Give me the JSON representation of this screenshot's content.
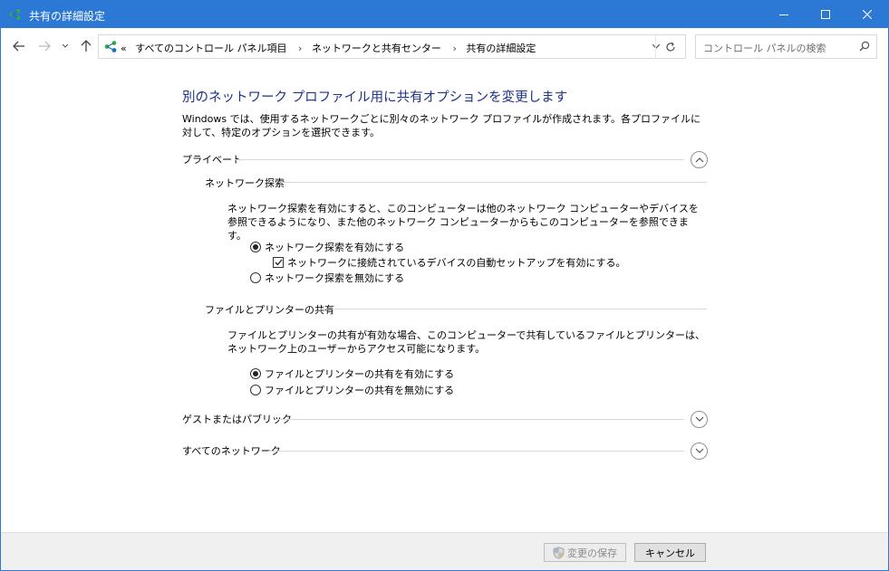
{
  "window": {
    "title": "共有の詳細設定"
  },
  "nav": {
    "breadcrumb_prefix": "«",
    "breadcrumbs": [
      "すべてのコントロール パネル項目",
      "ネットワークと共有センター",
      "共有の詳細設定"
    ],
    "separator": "›",
    "search_placeholder": "コントロール パネルの検索"
  },
  "main": {
    "heading": "別のネットワーク プロファイル用に共有オプションを変更します",
    "description": "Windows では、使用するネットワークごとに別々のネットワーク プロファイルが作成されます。各プロファイルに対して、特定のオプションを選択できます。",
    "profiles": {
      "private": {
        "label": "プライベート",
        "expanded": true
      },
      "guest": {
        "label": "ゲストまたはパブリック",
        "expanded": false
      },
      "all": {
        "label": "すべてのネットワーク",
        "expanded": false
      }
    },
    "discovery": {
      "label": "ネットワーク探索",
      "description": "ネットワーク探索を有効にすると、このコンピューターは他のネットワーク コンピューターやデバイスを参照できるようになり、また他のネットワーク コンピューターからもこのコンピューターを参照できます。",
      "on_label": "ネットワーク探索を有効にする",
      "auto_setup_label": "ネットワークに接続されているデバイスの自動セットアップを有効にする。",
      "off_label": "ネットワーク探索を無効にする",
      "selected": "on",
      "auto_setup_checked": true
    },
    "file_sharing": {
      "label": "ファイルとプリンターの共有",
      "description": "ファイルとプリンターの共有が有効な場合、このコンピューターで共有しているファイルとプリンターは、ネットワーク上のユーザーからアクセス可能になります。",
      "on_label": "ファイルとプリンターの共有を有効にする",
      "off_label": "ファイルとプリンターの共有を無効にする",
      "selected": "on"
    }
  },
  "footer": {
    "save_label": "変更の保存",
    "cancel_label": "キャンセル"
  },
  "colors": {
    "titlebar": "#2b79d5",
    "heading": "#1e3287"
  }
}
